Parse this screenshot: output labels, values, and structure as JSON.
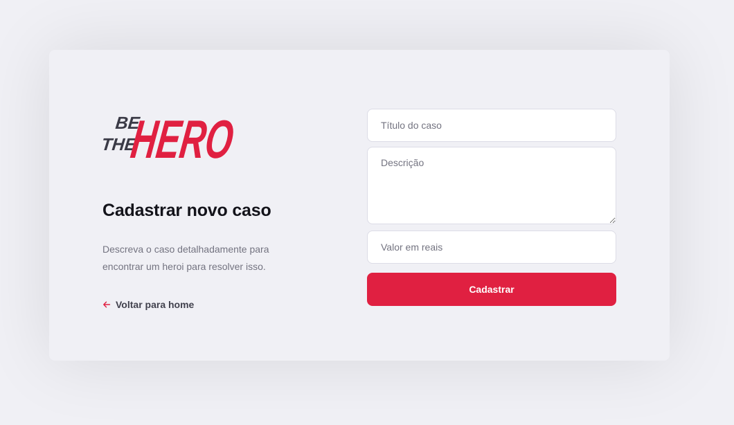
{
  "brand": {
    "logo_top": "BE",
    "logo_bottom": "THE",
    "logo_main": "HERO",
    "dark_color": "#3a3a46",
    "accent_color": "#e02041"
  },
  "page": {
    "title": "Cadastrar novo caso",
    "description": "Descreva o caso detalhadamente para encontrar um heroi para resolver isso.",
    "back_link_label": "Voltar para home",
    "back_icon": "arrow-left-icon"
  },
  "form": {
    "title_placeholder": "Título do caso",
    "title_value": "",
    "description_placeholder": "Descrição",
    "description_value": "",
    "value_placeholder": "Valor em reais",
    "value_value": "",
    "submit_label": "Cadastrar"
  }
}
